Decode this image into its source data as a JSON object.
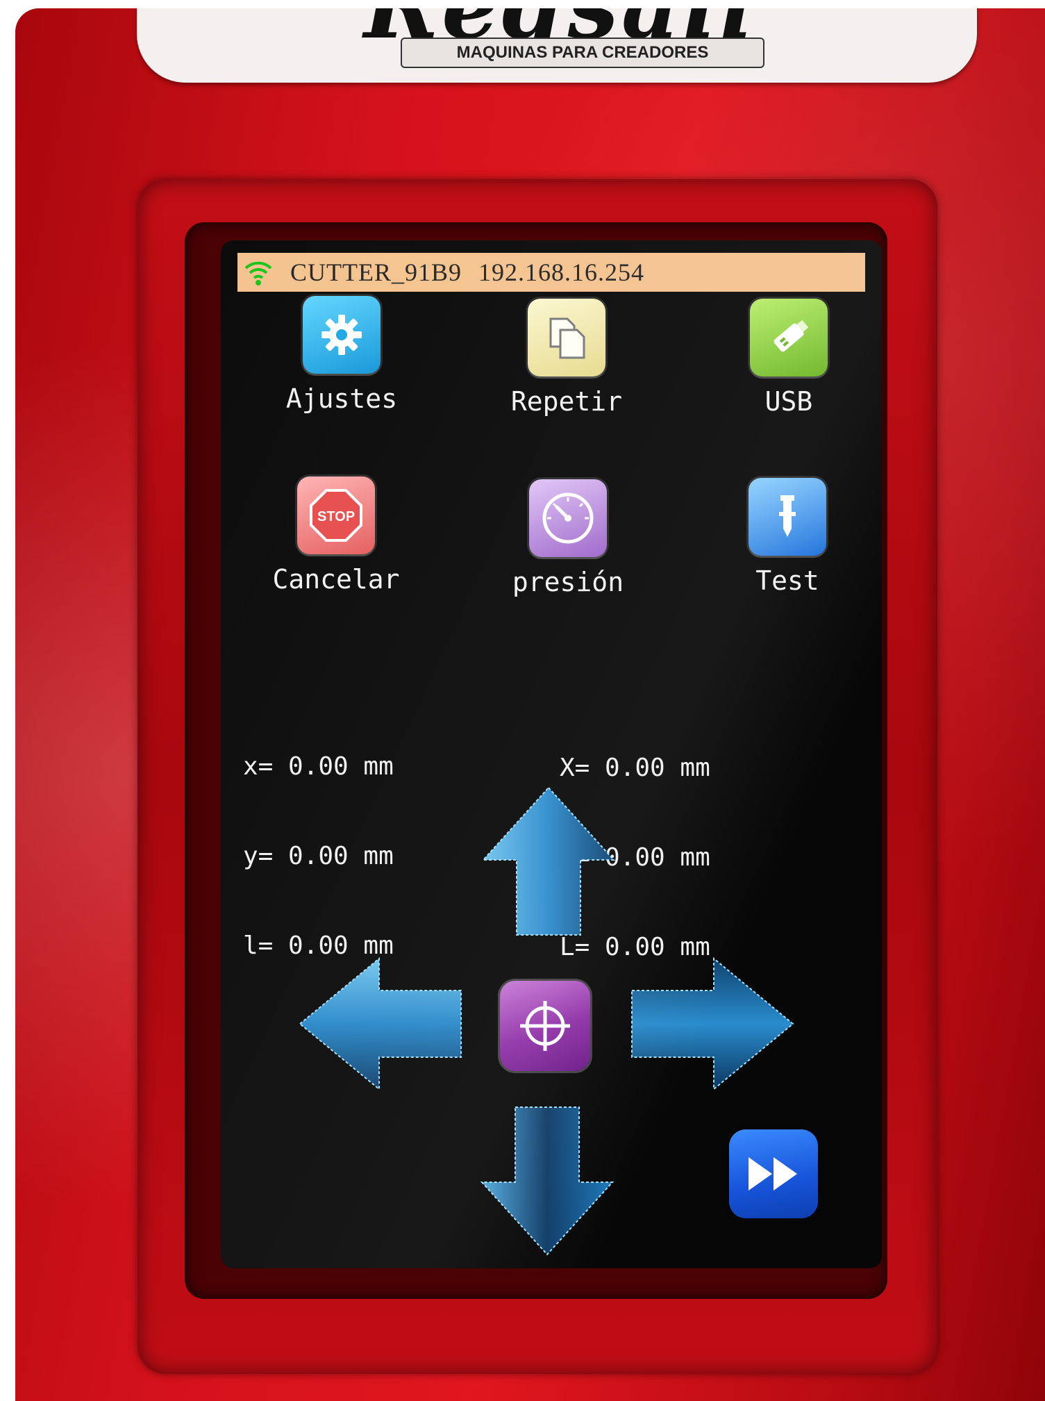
{
  "logo": {
    "brand": "Redsail",
    "tagline": "MAQUINAS PARA CREADORES"
  },
  "status_bar": {
    "network_name": "CUTTER_91B9",
    "ip_address": "192.168.16.254",
    "wifi_icon": "wifi-icon"
  },
  "menu": {
    "settings": {
      "label": "Ajustes",
      "icon": "gear-icon",
      "color": "#1fb2e8"
    },
    "repeat": {
      "label": "Repetir",
      "icon": "copy-icon",
      "color": "#f1e9a4"
    },
    "usb": {
      "label": "USB",
      "icon": "usb-drive-icon",
      "color": "#8ccf3a"
    },
    "cancel": {
      "label": "Cancelar",
      "icon": "stop-sign-icon",
      "color": "#f07b7b"
    },
    "pressure": {
      "label": "presión",
      "icon": "gauge-icon",
      "color": "#b28ad8"
    },
    "test": {
      "label": "Test",
      "icon": "blade-icon",
      "color": "#2f8de8"
    }
  },
  "coordinates": {
    "left": {
      "x": "x= 0.00 mm",
      "y": "y= 0.00 mm",
      "l": "l= 0.00 mm"
    },
    "right": {
      "x": "X= 0.00 mm",
      "y": "Y= 0.00 mm",
      "l": "L= 0.00 mm"
    }
  },
  "jog": {
    "up_icon": "arrow-up-icon",
    "down_icon": "arrow-down-icon",
    "left_icon": "arrow-left-icon",
    "right_icon": "arrow-right-icon",
    "origin_icon": "crosshair-icon",
    "next_icon": "fast-forward-icon"
  },
  "colors": {
    "machine_red": "#d4121b",
    "status_bar": "#f4c28d",
    "arrow_blue": "#1d7fc4"
  }
}
